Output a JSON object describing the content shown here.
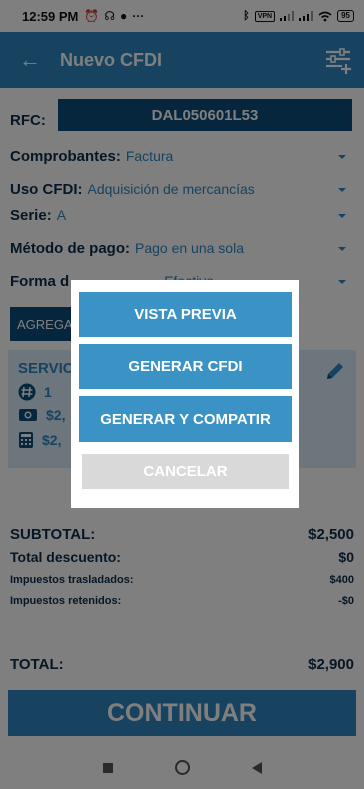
{
  "status_bar": {
    "time": "12:59 PM",
    "vpn": "VPN",
    "battery": "95",
    "icons": [
      "alarm-icon",
      "headphones-icon",
      "chat-icon",
      "more-icon",
      "bluetooth-icon",
      "signal-icon",
      "wifi-icon"
    ]
  },
  "app_bar": {
    "title": "Nuevo CFDI",
    "back_icon": "arrow-left-icon",
    "filter_icon": "filter-settings-icon"
  },
  "form": {
    "rfc_label": "RFC:",
    "rfc_value": "DAL050601L53",
    "comprobantes_label": "Comprobantes:",
    "comprobantes_value": "Factura",
    "uso_cfdi_label": "Uso CFDI:",
    "uso_cfdi_value": "Adquisición de mercancías",
    "serie_label": "Serie:",
    "serie_value": "A",
    "metodo_label": "Método de pago:",
    "metodo_value": "Pago en una sola",
    "forma_label": "Forma d",
    "forma_value": "Efectivo",
    "add_button": "AGREGAR"
  },
  "service": {
    "name": "SERVIC",
    "quantity": "1",
    "price": "$2,",
    "total": "$2,"
  },
  "totals": {
    "subtotal_label": "SUBTOTAL:",
    "subtotal_value": "$2,500",
    "descuento_label": "Total descuento:",
    "descuento_value": "$0",
    "trasladados_label": "Impuestos trasladados:",
    "trasladados_value": "$400",
    "retenidos_label": "Impuestos retenidos:",
    "retenidos_value": "-$0",
    "total_label": "TOTAL:",
    "total_value": "$2,900"
  },
  "continue_button": "CONTINUAR",
  "dialog": {
    "preview": "VISTA PREVIA",
    "generate": "GENERAR CFDI",
    "generate_share": "GENERAR Y COMPATIR",
    "cancel": "CANCELAR"
  },
  "colors": {
    "primary": "#2e86c1",
    "dark": "#0d4d7a",
    "text_dark": "#0d2d4a",
    "card_bg": "#d9ecf8",
    "dialog_button": "#3a93c4",
    "cancel_button": "#d9d9d9"
  }
}
